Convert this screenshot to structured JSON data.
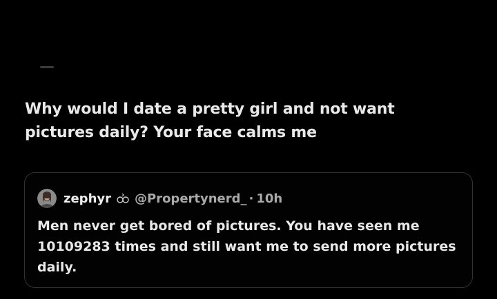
{
  "post": {
    "text": "Why would I date a pretty girl and not want pictures daily? Your face calms me"
  },
  "quoted_post": {
    "display_name": "zephyr",
    "badge_icon": "infinity-loop-icon",
    "handle": "@Propertynerd_",
    "separator": "·",
    "time": "10h",
    "text": "Men never get bored of pictures. You have seen me 10109283 times and still want me to send more pictures daily."
  },
  "colors": {
    "background": "#000000",
    "text_primary": "#e9e9e9",
    "text_secondary": "#a9a9a9",
    "card_border": "#2f3336"
  }
}
